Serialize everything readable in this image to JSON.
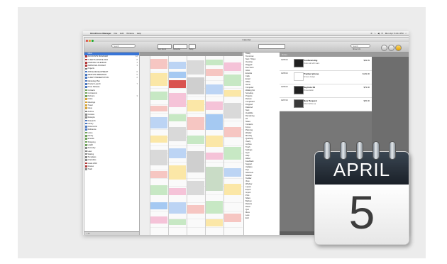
{
  "menubar": {
    "app_name": "OmniFocus Manager",
    "menus": [
      "File",
      "Edit",
      "Window",
      "Help"
    ],
    "status": [
      "≋",
      "⌁",
      "◀",
      "✉",
      "Mon Apr 5 4:41 PM",
      "⌕"
    ]
  },
  "window": {
    "title": "Calendar",
    "search_placeholder": "Search",
    "toolbar_labels": [
      "New Event",
      "Calendar",
      "Today"
    ],
    "right_label": "Show Info"
  },
  "sidebar": {
    "items": [
      {
        "label": "Inbox",
        "count": "",
        "color": "#3875d7",
        "selected": true
      },
      {
        "label": "ACCOUNTS MANAGER",
        "count": "12",
        "color": "#b33a3a"
      },
      {
        "label": "CLIENTS UPDATE 2010",
        "count": "8",
        "color": "#b33a3a"
      },
      {
        "label": "FINANCE CALENDAR",
        "count": "4",
        "color": "#b33a3a"
      },
      {
        "label": "PERSONAL BUDGET",
        "count": "3",
        "color": "#b33a3a"
      },
      {
        "label": "Projects",
        "count": "",
        "color": "#7a7a7a"
      },
      {
        "label": "APPLE DEVELOPMENT",
        "count": "6",
        "color": "#4a78c2"
      },
      {
        "label": "WEB SITE REDESIGN",
        "count": "5",
        "color": "#4a78c2"
      },
      {
        "label": "CLIENT PRESENTATION",
        "count": "2",
        "color": "#4a78c2"
      },
      {
        "label": "Marketing Plan",
        "count": "",
        "color": "#4a78c2"
      },
      {
        "label": "Product Launch",
        "count": "7",
        "color": "#4a78c2"
      },
      {
        "label": "Press Release",
        "count": "",
        "color": "#4a78c2"
      },
      {
        "label": "Contacts",
        "count": "",
        "color": "#6fa35a"
      },
      {
        "label": "Contractors",
        "count": "",
        "color": "#6fa35a"
      },
      {
        "label": "Partners",
        "count": "3",
        "color": "#6fa35a"
      },
      {
        "label": "Notes",
        "count": "",
        "color": "#d6a43a"
      },
      {
        "label": "Meetings",
        "count": "",
        "color": "#d6a43a"
      },
      {
        "label": "Travel",
        "count": "",
        "color": "#d6a43a"
      },
      {
        "label": "Ideas",
        "count": "",
        "color": "#d6a43a"
      },
      {
        "label": "Archive",
        "count": "",
        "color": "#888"
      },
      {
        "label": "Invoices",
        "count": "",
        "color": "#888"
      },
      {
        "label": "Receipts",
        "count": "",
        "color": "#888"
      },
      {
        "label": "Research",
        "count": "",
        "color": "#4a78c2"
      },
      {
        "label": "Library",
        "count": "",
        "color": "#4a78c2"
      },
      {
        "label": "Documents",
        "count": "",
        "color": "#4a78c2"
      },
      {
        "label": "Reference",
        "count": "",
        "color": "#4a78c2"
      },
      {
        "label": "Home",
        "count": "",
        "color": "#6fa35a"
      },
      {
        "label": "Family",
        "count": "",
        "color": "#6fa35a"
      },
      {
        "label": "Errands",
        "count": "",
        "color": "#6fa35a"
      },
      {
        "label": "Shopping",
        "count": "",
        "color": "#6fa35a"
      },
      {
        "label": "Health",
        "count": "",
        "color": "#6fa35a"
      },
      {
        "label": "Someday",
        "count": "",
        "color": "#888"
      },
      {
        "label": "Later",
        "count": "",
        "color": "#888"
      },
      {
        "label": "Waiting",
        "count": "",
        "color": "#888"
      },
      {
        "label": "Templates",
        "count": "",
        "color": "#888"
      },
      {
        "label": "Checklists",
        "count": "",
        "color": "#888"
      },
      {
        "label": "Goals 2010",
        "count": "",
        "color": "#b33a3a"
      },
      {
        "label": "Review",
        "count": "",
        "color": "#b33a3a"
      },
      {
        "label": "Trash",
        "count": "",
        "color": "#888"
      }
    ],
    "footer": "+  ⚙"
  },
  "agenda": {
    "items": [
      "Today",
      "Tomorrow",
      "Next 7 Days",
      "Overdue",
      "Flagged",
      "Due Soon",
      "Inbox",
      "Errands",
      "Calls",
      "Email",
      "Office",
      "Home",
      "Computer",
      "Waiting For",
      "Someday",
      "Projects",
      "Review",
      "Completed",
      "Dropped",
      "Deferred",
      "Next",
      "Available",
      "Remaining",
      "All",
      "Notes",
      "Contexts",
      "Focus",
      "Planning",
      "Weekly",
      "Monthly",
      "Quarterly",
      "Yearly",
      "Archive",
      "Trash",
      "Settings",
      "Sync",
      "Help",
      "About",
      "Feedback",
      "Support",
      "Updates",
      "Tips",
      "Shortcuts",
      "Sidebar",
      "Toolbar",
      "View",
      "Window",
      "Layout",
      "Export",
      "Import",
      "Print",
      "Share",
      "Backup",
      "Restore",
      "Reset",
      "Quit",
      "More",
      "Less",
      "End"
    ]
  },
  "detail": {
    "header": "Notes",
    "rows": [
      {
        "date": "04/05/10",
        "title": "Conferencing",
        "meta": "Video call with team",
        "amount": "$49.99"
      },
      {
        "date": "04/05/10",
        "title": "Tracker iphone",
        "meta": "Screen design",
        "amount": "$129.00"
      },
      {
        "date": "04/06/10",
        "title": "Keynote 09",
        "meta": "Presentation",
        "amount": "$79.00"
      },
      {
        "date": "04/07/10",
        "title": "New Request",
        "meta": "Client follow-up",
        "amount": "$25.00"
      }
    ]
  },
  "calendar_icon": {
    "month": "APRIL",
    "day": "5"
  },
  "colors": {
    "accent": "#3875d7",
    "icon_header": "#2a333d"
  }
}
